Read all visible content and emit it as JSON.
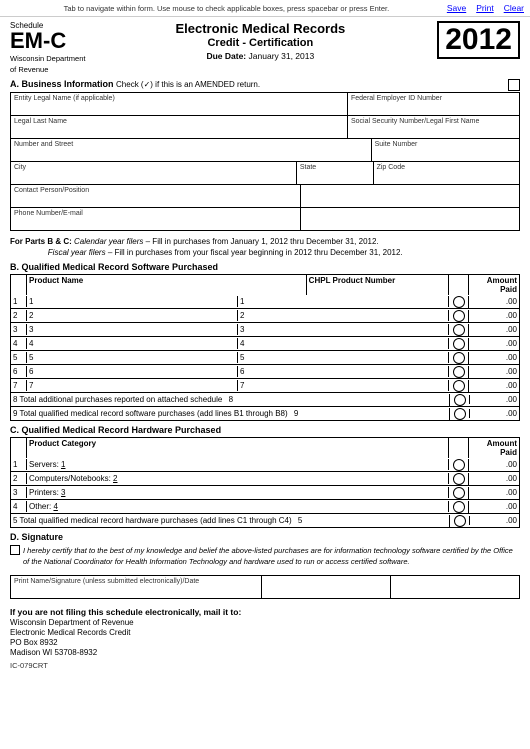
{
  "topBar": {
    "note": "Tab to navigate within form. Use mouse to check applicable boxes, press spacebar or press Enter.",
    "saveLabel": "Save",
    "printLabel": "Print",
    "clearLabel": "Clear"
  },
  "header": {
    "schedulePrefix": "Schedule",
    "scheduleId": "EM-C",
    "deptLine1": "Wisconsin Department",
    "deptLine2": "of Revenue",
    "title1": "Electronic Medical Records",
    "title2": "Credit - Certification",
    "dueDateLabel": "Due Date:",
    "dueDateValue": "January 31, 2013",
    "year": "2012"
  },
  "sectionA": {
    "title": "A. Business Information",
    "checkLabel": "Check (✓) if this is an AMENDED return.",
    "fields": {
      "entityName": "Entity Legal Name (if applicable)",
      "federalEIN": "Federal Employer ID Number",
      "legalLastName": "Legal Last Name",
      "ssn": "Social Security Number/Legal First Name",
      "numberStreet": "Number and Street",
      "suiteNumber": "Suite Number",
      "city": "City",
      "state": "State",
      "zip": "Zip Code",
      "contactPerson": "Contact Person/Position",
      "phoneEmail": "Phone Number/E-mail"
    }
  },
  "forParts": {
    "text1": "For Parts B & C:",
    "calLabel": "Calendar year filers",
    "calText": " – Fill in purchases from January 1, 2012 thru December 31, 2012.",
    "fiscalLabel": "Fiscal year filers",
    "fiscalText": " – Fill in purchases from your fiscal year beginning in 2012 thru December 31, 2012."
  },
  "sectionB": {
    "title": "B. Qualified Medical Record Software Purchased",
    "headerProductName": "Product Name",
    "headerCHPL": "CHPL Product Number",
    "headerAmountPaid": "Amount Paid",
    "rows": [
      {
        "num": "1",
        "col1": "1",
        "col2": "1"
      },
      {
        "num": "2",
        "col1": "2",
        "col2": "2"
      },
      {
        "num": "3",
        "col1": "3",
        "col2": "3"
      },
      {
        "num": "4",
        "col1": "4",
        "col2": "4"
      },
      {
        "num": "5",
        "col1": "5",
        "col2": "5"
      },
      {
        "num": "6",
        "col1": "6",
        "col2": "6"
      },
      {
        "num": "7",
        "col1": "7",
        "col2": "7"
      }
    ],
    "row8Label": "8 Total additional purchases reported on attached schedule",
    "row8Num": "8",
    "row9Label": "9 Total qualified medical record software purchases (add lines B1 through B8)",
    "row9Num": "9",
    "amount": ".00"
  },
  "sectionC": {
    "title": "C. Qualified Medical Record Hardware Purchased",
    "headerCategory": "Product Category",
    "headerAmountPaid": "Amount Paid",
    "rows": [
      {
        "num": "1",
        "label": "Servers:",
        "value": "1"
      },
      {
        "num": "2",
        "label": "Computers/Notebooks:",
        "value": "2"
      },
      {
        "num": "3",
        "label": "Printers:",
        "value": "3"
      },
      {
        "num": "4",
        "label": "Other:",
        "value": "4"
      }
    ],
    "row5Label": "5 Total qualified medical record hardware purchases (add lines C1 through C4)",
    "row5Num": "5",
    "amount": ".00"
  },
  "sectionD": {
    "title": "D. Signature",
    "certText": "I hereby certify that to the best of my knowledge and belief the above-listed purchases are for information technology software certified by the Office of the National Coordinator for Health Information Technology and hardware used to run or access certified software.",
    "signatureLabel": "Print Name/Signature (unless submitted electronically)/Date"
  },
  "mailingSection": {
    "ifNotFiling": "If you are not filing this schedule electronically, mail it to:",
    "line1": "Wisconsin Department of Revenue",
    "line2": "Electronic Medical Records Credit",
    "line3": "PO Box 8932",
    "line4": "Madison WI 53708-8932"
  },
  "formCode": "IC-079CRT"
}
